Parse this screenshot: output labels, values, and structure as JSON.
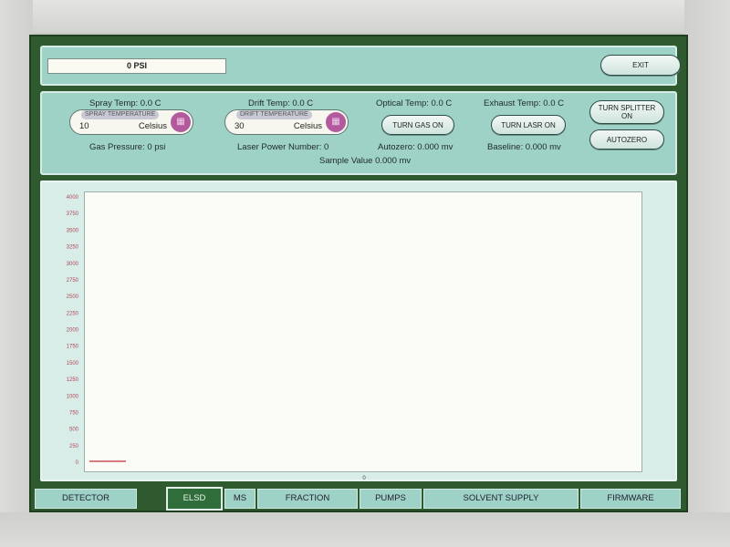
{
  "header": {
    "pressure_display": "0 PSI",
    "exit_label": "EXIT"
  },
  "temps": {
    "spray_temp": "Spray Temp: 0.0 C",
    "drift_temp": "Drift Temp: 0.0 C",
    "optical_temp": "Optical Temp: 0.0 C",
    "exhaust_temp": "Exhaust Temp: 0.0 C",
    "spray_field": {
      "title": "SPRAY TEMPERATURE",
      "value": "10",
      "unit": "Celsius"
    },
    "drift_field": {
      "title": "DRIFT TEMPERATURE",
      "value": "30",
      "unit": "Celsius"
    },
    "turn_gas_on": "TURN GAS ON",
    "turn_lasr_on": "TURN LASR ON",
    "turn_splitter_on": "TURN SPLITTER ON",
    "autozero_button": "AUTOZERO",
    "gas_pressure": "Gas Pressure: 0 psi",
    "laser_power": "Laser Power Number: 0",
    "autozero_value": "Autozero: 0.000 mv",
    "baseline": "Baseline: 0.000 mv",
    "sample_value": "Sample Value 0.000 mv"
  },
  "chart_data": {
    "type": "line",
    "title": "",
    "xlabel": "",
    "ylabel": "",
    "x_ticks": [
      "0"
    ],
    "y_ticks": [
      "4000",
      "3750",
      "3500",
      "3250",
      "3000",
      "2750",
      "2500",
      "2250",
      "2000",
      "1750",
      "1500",
      "1250",
      "1000",
      "750",
      "500",
      "250",
      "0"
    ],
    "ylim": [
      0,
      4000
    ],
    "series": [
      {
        "color": "#c0303a",
        "x": [
          0,
          1
        ],
        "y": [
          0,
          0
        ]
      }
    ],
    "grid": false
  },
  "tabs": [
    {
      "label": "DETECTOR",
      "active": false
    },
    {
      "label": "ELSD",
      "active": true
    },
    {
      "label": "MS",
      "active": false
    },
    {
      "label": "FRACTION",
      "active": false
    },
    {
      "label": "PUMPS",
      "active": false
    },
    {
      "label": "SOLVENT SUPPLY",
      "active": false
    },
    {
      "label": "FIRMWARE",
      "active": false
    }
  ],
  "colors": {
    "panel": "#9ed2c6",
    "screen_bg": "#2f5a2f",
    "active_tab": "#2f6e3a",
    "tick_label": "#b04a5a",
    "trace": "#c0303a"
  }
}
